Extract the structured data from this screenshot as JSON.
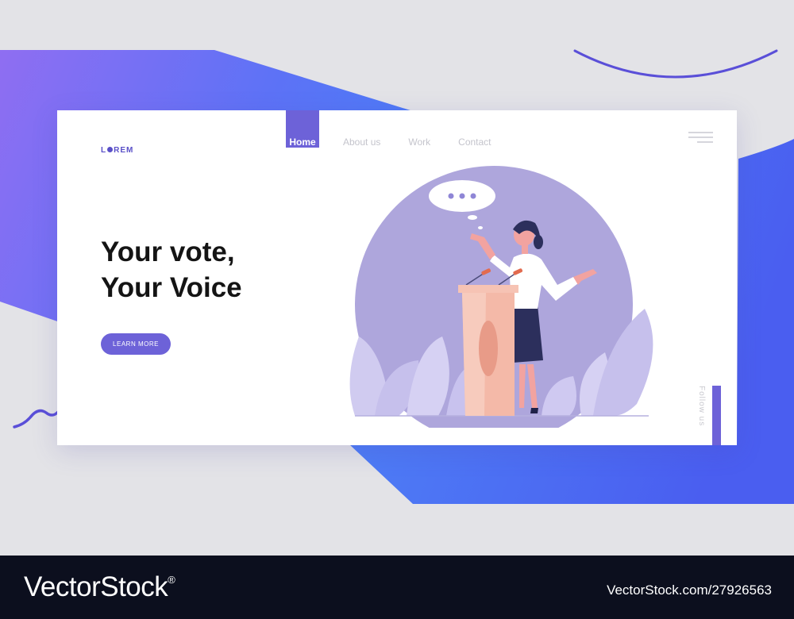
{
  "logo": {
    "prefix": "L",
    "suffix": "REM"
  },
  "nav": {
    "items": [
      {
        "label": "Home",
        "active": true
      },
      {
        "label": "About us",
        "active": false
      },
      {
        "label": "Work",
        "active": false
      },
      {
        "label": "Contact",
        "active": false
      }
    ],
    "menu_icon": "hamburger-icon"
  },
  "hero": {
    "headline_line1": "Your vote,",
    "headline_line2": "Your Voice",
    "cta_label": "LEARN MORE"
  },
  "follow": {
    "label": "Follow us"
  },
  "colors": {
    "accent": "#6d62d8",
    "gradient_start": "#8e6df0",
    "gradient_end": "#4a6cf7",
    "illustration_circle": "#aea6dc",
    "footer": "#0c0f1e"
  },
  "watermark": {
    "brand": "VectorStock",
    "registered": "®",
    "url": "VectorStock.com/27926563"
  }
}
